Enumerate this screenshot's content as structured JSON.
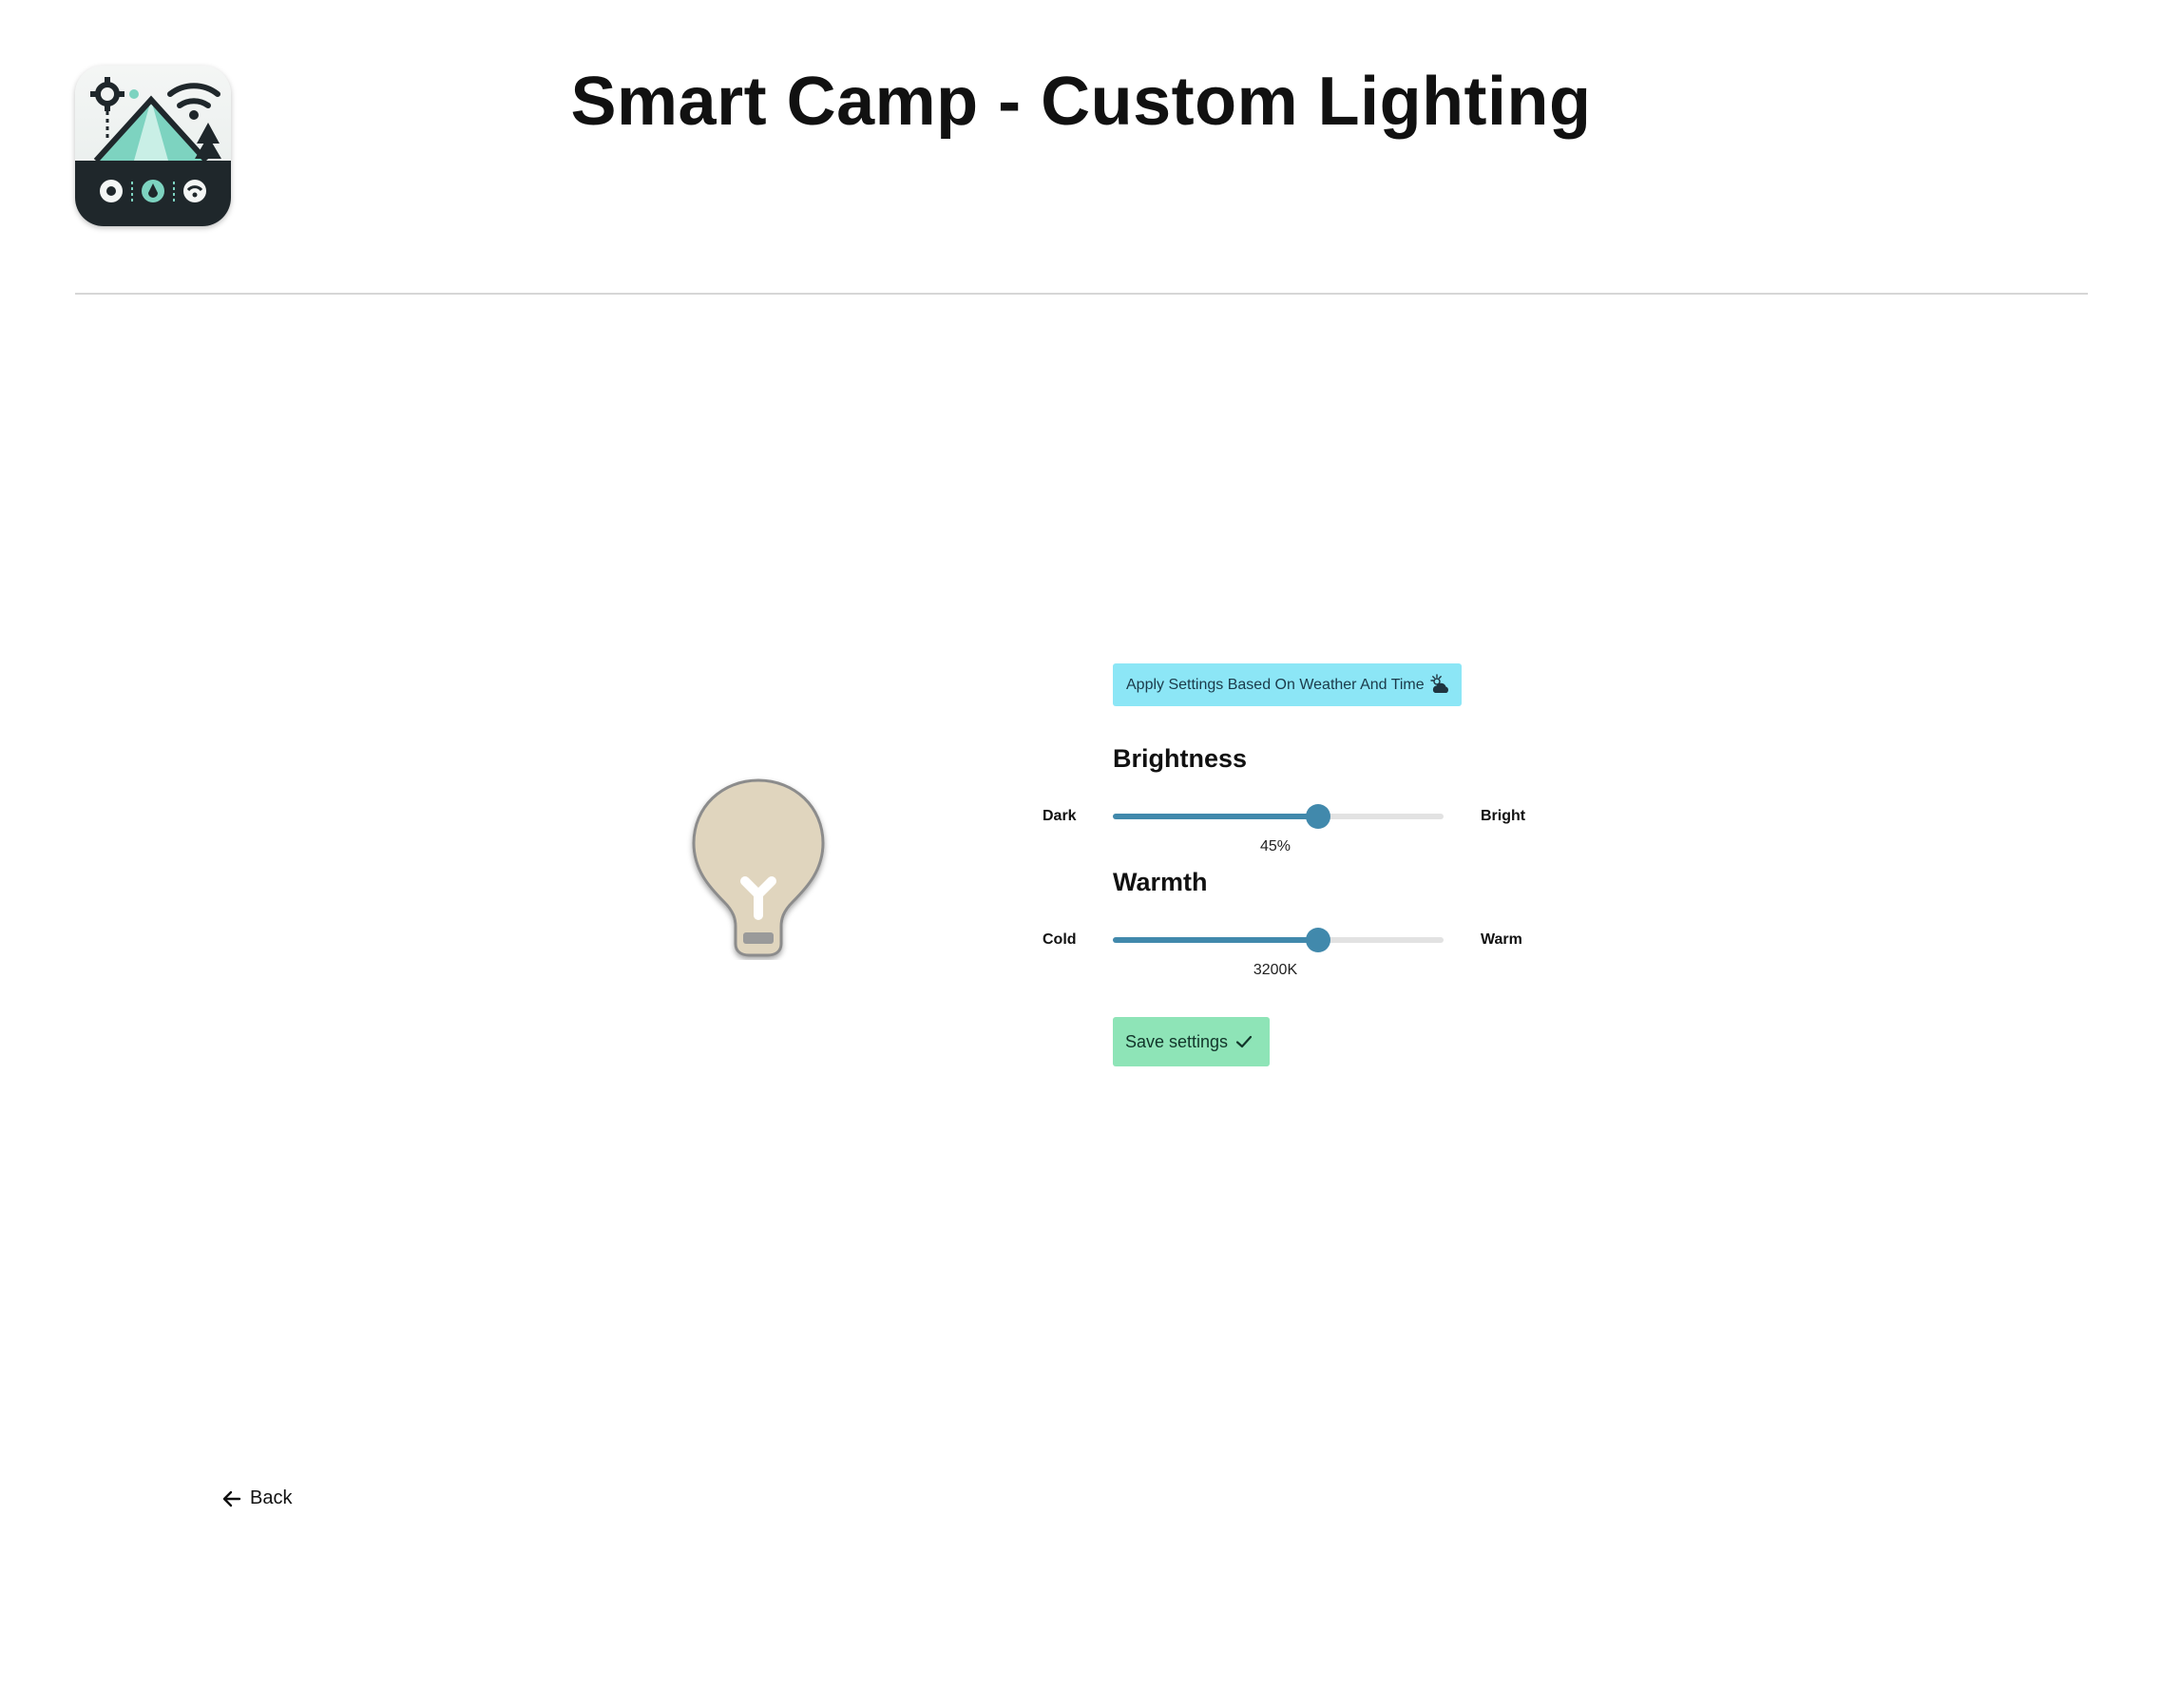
{
  "header": {
    "title": "Smart Camp - Custom Lighting"
  },
  "auto_apply": {
    "label": "Apply Settings Based On Weather And Time",
    "icon": "weather-sun-cloud-icon"
  },
  "brightness": {
    "title": "Brightness",
    "min_label": "Dark",
    "max_label": "Bright",
    "value_text": "45%",
    "slider_fraction": 0.62
  },
  "warmth": {
    "title": "Warmth",
    "min_label": "Cold",
    "max_label": "Warm",
    "value_text": "3200K",
    "slider_fraction": 0.62
  },
  "save": {
    "label": "Save settings",
    "icon": "check-icon"
  },
  "back": {
    "label": "Back",
    "icon": "arrow-left-icon"
  },
  "colors": {
    "accent": "#4189ac",
    "auto_button_bg": "#8ce6f6",
    "save_button_bg": "#8ee4b7",
    "bulb_fill": "#e0d5be",
    "logo_bg_dark": "#1f272b",
    "logo_teal": "#7dd3c0"
  }
}
